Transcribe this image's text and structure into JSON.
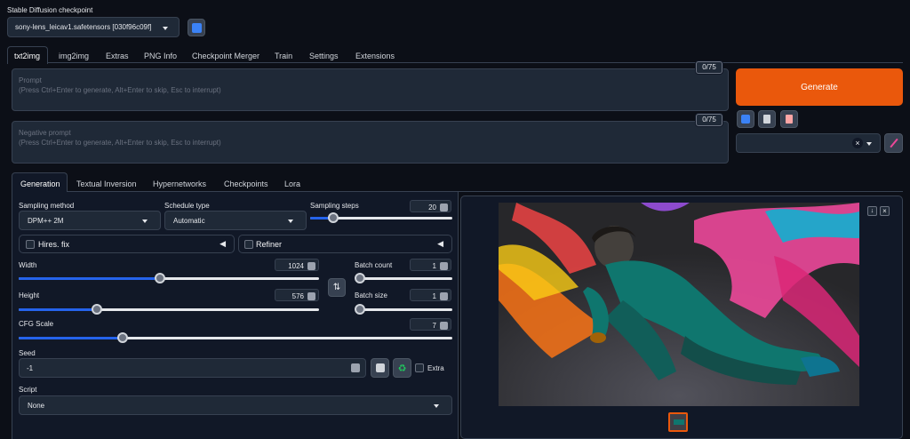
{
  "checkpoint": {
    "label": "Stable Diffusion checkpoint",
    "value": "sony-lens_leicav1.safetensors [030f96c09f]"
  },
  "main_tabs": [
    "txt2img",
    "img2img",
    "Extras",
    "PNG Info",
    "Checkpoint Merger",
    "Train",
    "Settings",
    "Extensions"
  ],
  "prompt": {
    "label": "Prompt",
    "hint": "(Press Ctrl+Enter to generate, Alt+Enter to skip, Esc to interrupt)",
    "counter": "0/75"
  },
  "negative_prompt": {
    "label": "Negative prompt",
    "hint": "(Press Ctrl+Enter to generate, Alt+Enter to skip, Esc to interrupt)",
    "counter": "0/75"
  },
  "generate_label": "Generate",
  "accent_color": "#ea580c",
  "sub_tabs": [
    "Generation",
    "Textual Inversion",
    "Hypernetworks",
    "Checkpoints",
    "Lora"
  ],
  "sampling": {
    "method_label": "Sampling method",
    "method_value": "DPM++ 2M",
    "schedule_label": "Schedule type",
    "schedule_value": "Automatic",
    "steps_label": "Sampling steps",
    "steps_value": "20"
  },
  "hires_label": "Hires. fix",
  "refiner_label": "Refiner",
  "width": {
    "label": "Width",
    "value": "1024"
  },
  "height": {
    "label": "Height",
    "value": "576"
  },
  "batch_count": {
    "label": "Batch count",
    "value": "1"
  },
  "batch_size": {
    "label": "Batch size",
    "value": "1"
  },
  "cfg": {
    "label": "CFG Scale",
    "value": "7"
  },
  "seed": {
    "label": "Seed",
    "value": "-1",
    "extra_label": "Extra"
  },
  "script": {
    "label": "Script",
    "value": "None"
  },
  "slider_levels": {
    "steps": 0.16,
    "width": 0.47,
    "height": 0.26,
    "cfg": 0.24,
    "batch_count": 0.0,
    "batch_size": 0.0
  }
}
